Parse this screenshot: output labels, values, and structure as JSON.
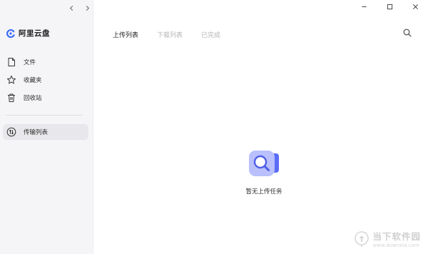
{
  "brand": {
    "name": "阿里云盘"
  },
  "sidebar": {
    "items": [
      {
        "label": "文件",
        "icon": "file-icon"
      },
      {
        "label": "收藏夹",
        "icon": "star-icon"
      },
      {
        "label": "回收站",
        "icon": "trash-icon"
      }
    ],
    "transfer": {
      "label": "传输列表",
      "icon": "transfer-icon",
      "active": true
    }
  },
  "tabs": [
    {
      "label": "上传列表",
      "active": true
    },
    {
      "label": "下载列表",
      "active": false
    },
    {
      "label": "已完成",
      "active": false
    }
  ],
  "empty_state": {
    "text": "暂无上传任务"
  },
  "watermark": {
    "name": "当下软件园",
    "url": "www.downxia.com"
  },
  "colors": {
    "accent": "#5b6cf6",
    "brand_blue": "#3b6cf5",
    "sidebar_bg": "#f5f5f7",
    "active_item_bg": "#e8e8ec",
    "inactive_tab": "#b5b5ba"
  }
}
